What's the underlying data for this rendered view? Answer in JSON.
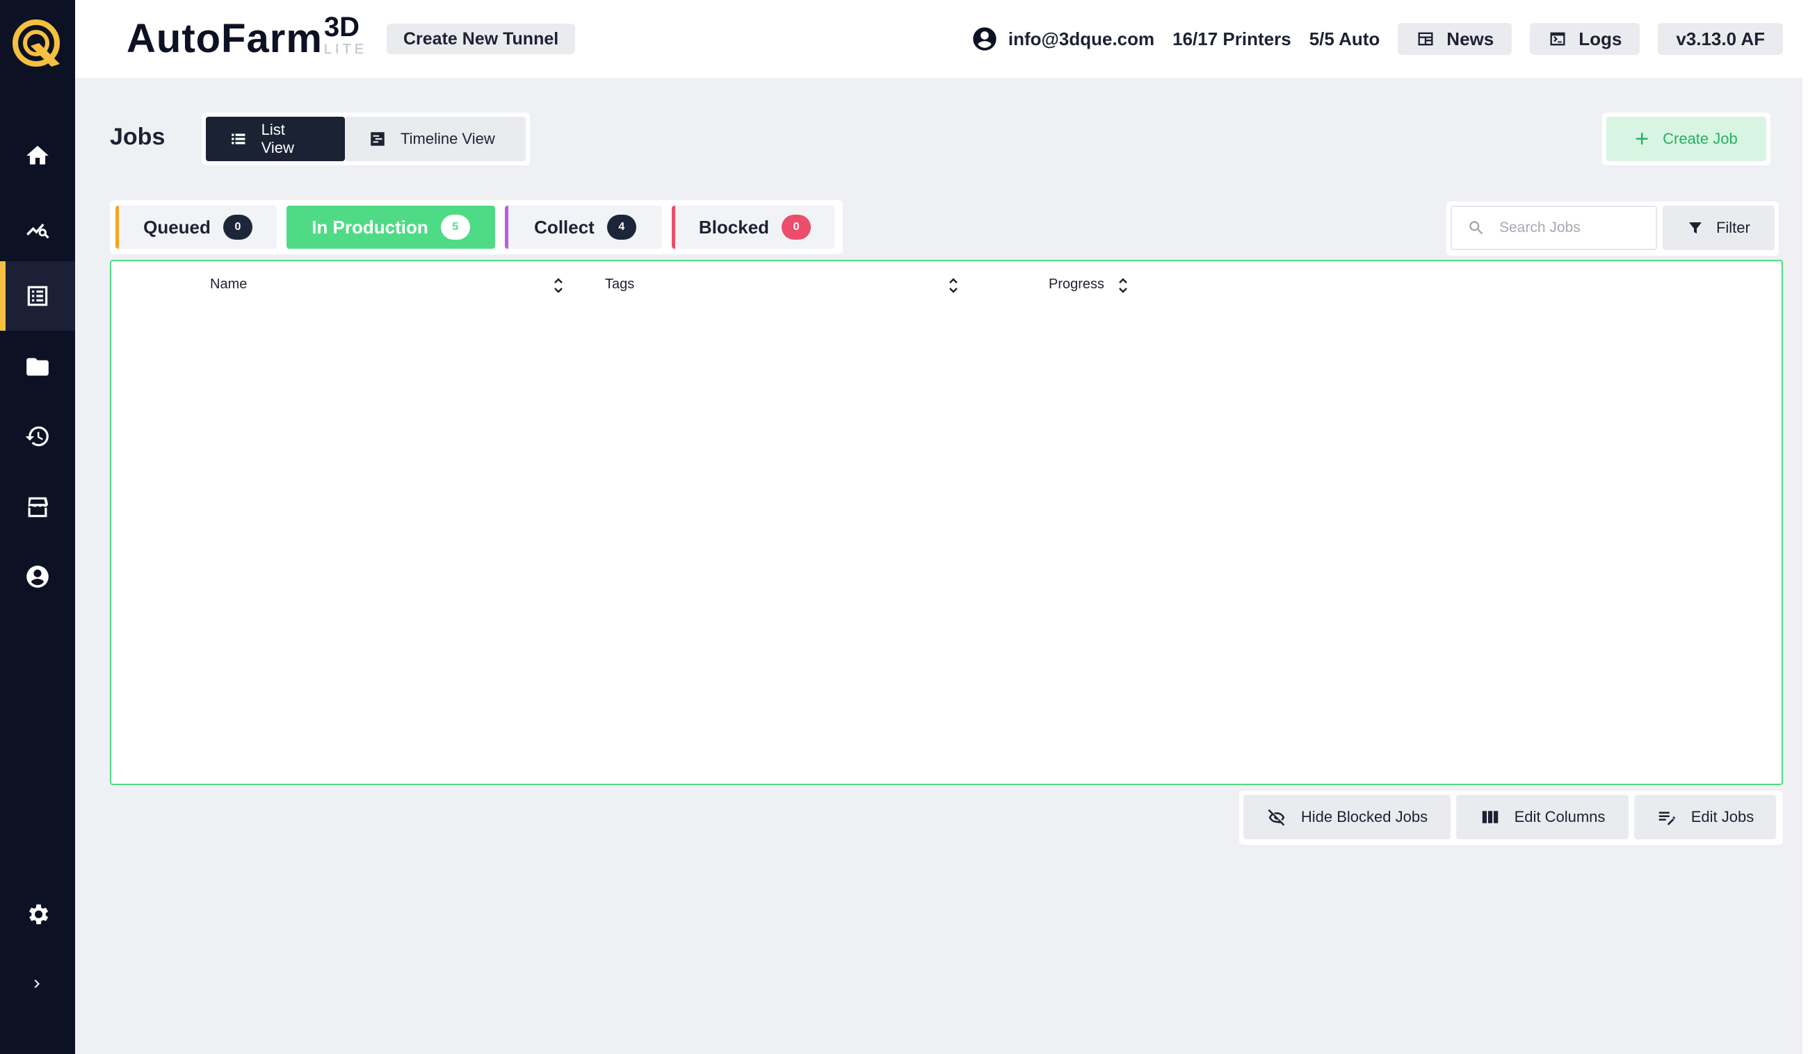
{
  "brand": {
    "name": "AutoFarm",
    "sup": "3D",
    "sub": "LITE"
  },
  "topbar": {
    "tunnel_button": "Create New Tunnel",
    "user_email": "info@3dque.com",
    "printers": "16/17 Printers",
    "auto": "5/5 Auto",
    "news_button": "News",
    "logs_button": "Logs",
    "version": "v3.13.0 AF"
  },
  "sidebar": {
    "items": [
      "home-icon",
      "analytics-icon",
      "jobs-icon",
      "folder-icon",
      "history-icon",
      "store-icon",
      "account-icon"
    ],
    "active": "jobs-icon",
    "bottom": [
      "settings-icon",
      "expand-chevron-icon"
    ]
  },
  "jobs": {
    "title": "Jobs",
    "list_view": "List View",
    "timeline_view": "Timeline View",
    "create_job": "Create Job"
  },
  "tabs": [
    {
      "label": "Queued",
      "count": "0",
      "color": "#f5a524"
    },
    {
      "label": "In Production",
      "count": "5",
      "color": "#4fdb86"
    },
    {
      "label": "Collect",
      "count": "4",
      "color": "#b75ee0"
    },
    {
      "label": "Blocked",
      "count": "0",
      "color": "#ec4d6b"
    }
  ],
  "search": {
    "placeholder": "Search Jobs",
    "value": ""
  },
  "filter_button": "Filter",
  "table": {
    "columns": [
      "Name",
      "Tags",
      "Progress"
    ],
    "rows": []
  },
  "actions": {
    "hide_blocked": "Hide Blocked Jobs",
    "edit_columns": "Edit Columns",
    "edit_jobs": "Edit Jobs"
  },
  "colors": {
    "sidebar_bg": "#0d1124",
    "accent": "#f5c041",
    "success": "#4fdb86"
  }
}
